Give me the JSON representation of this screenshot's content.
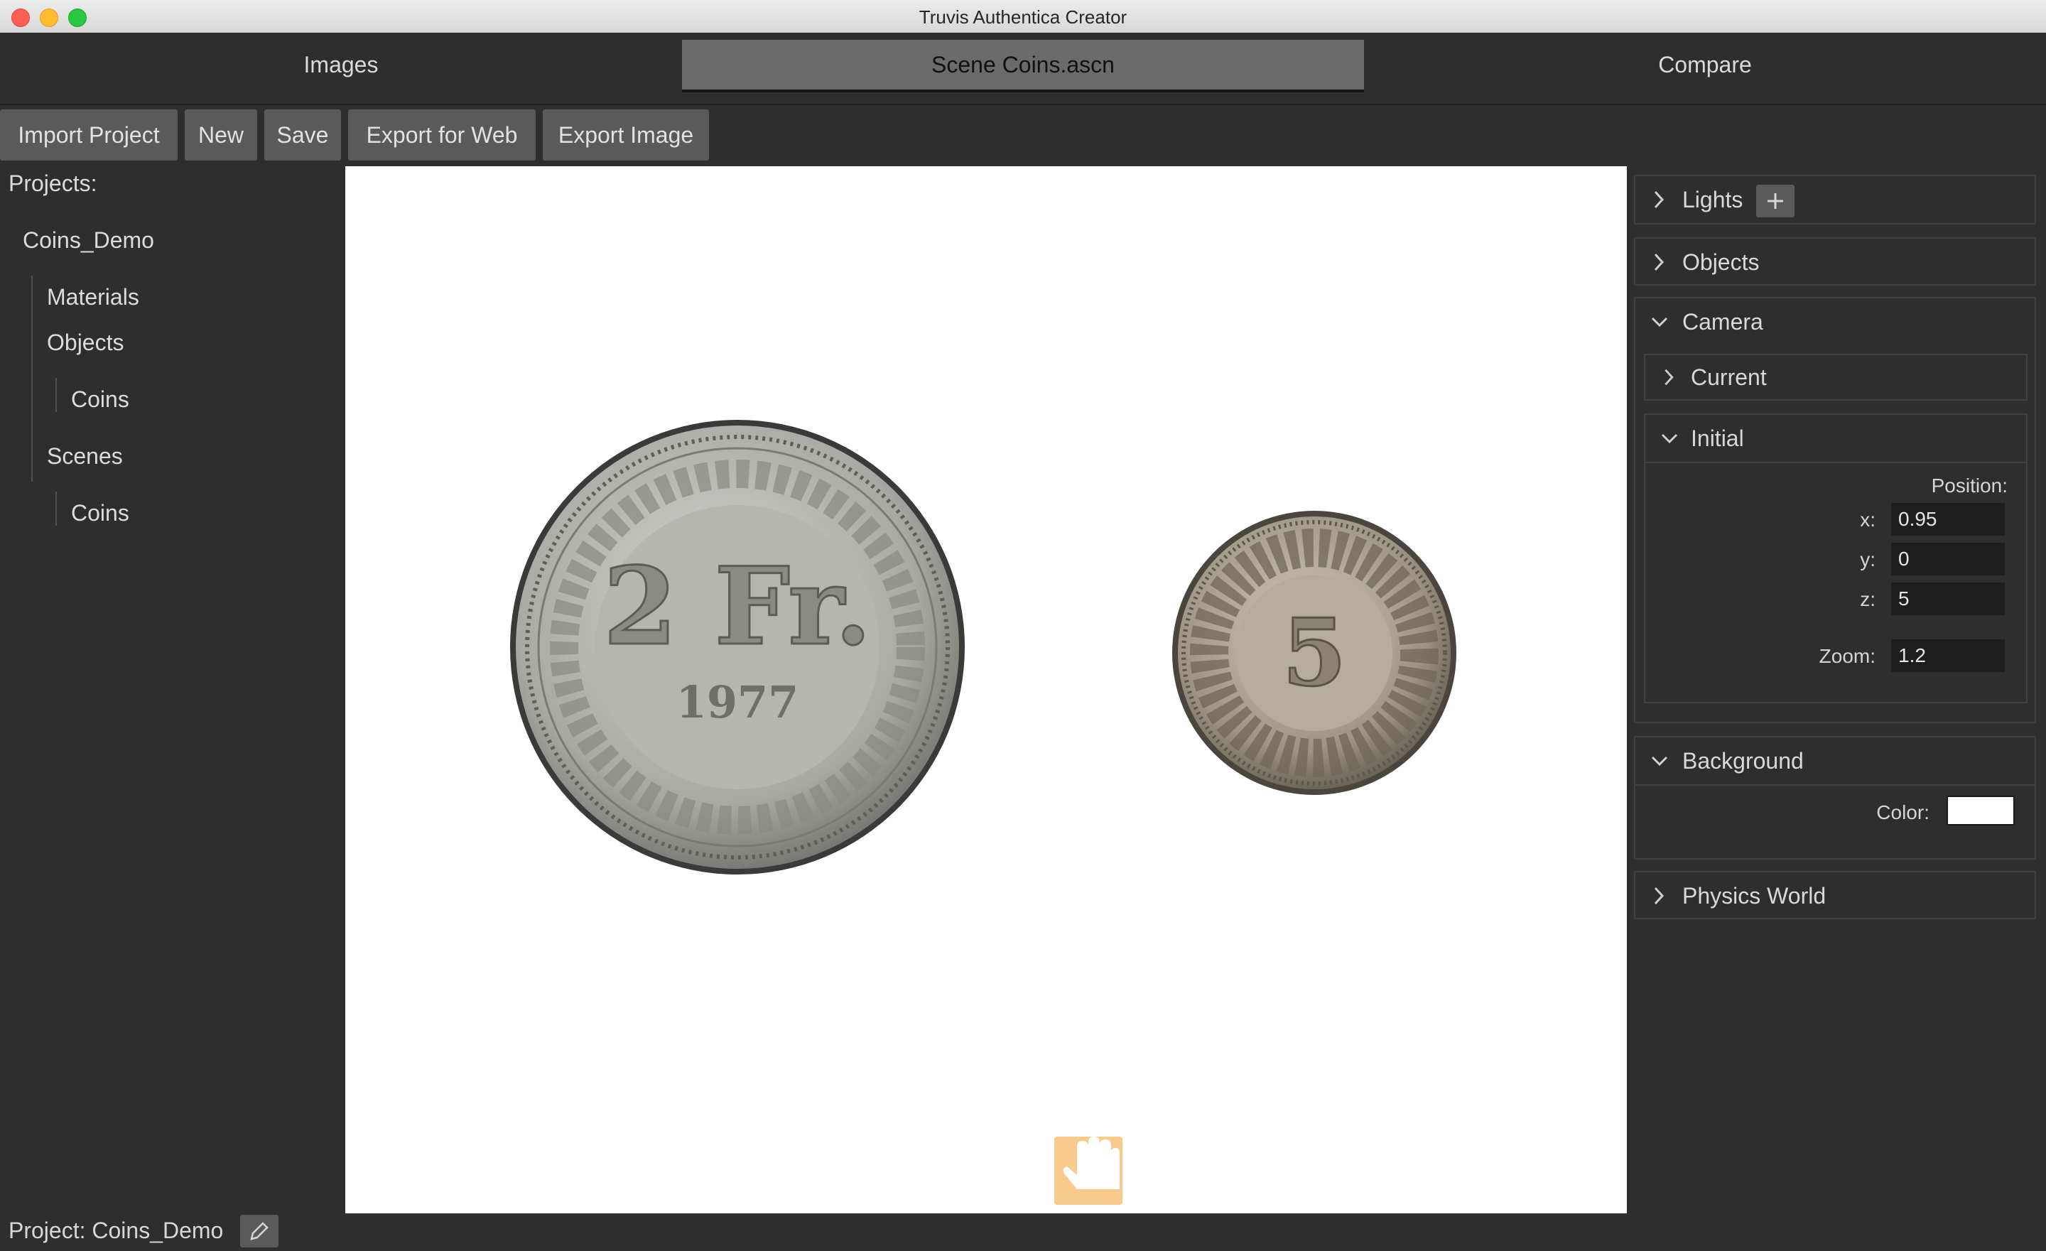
{
  "window": {
    "title": "Truvis Authentica Creator"
  },
  "tabs": [
    {
      "label": "Images",
      "active": false
    },
    {
      "label": "Scene Coins.ascn",
      "active": true
    },
    {
      "label": "Compare",
      "active": false
    }
  ],
  "toolbar": {
    "import_project": "Import Project",
    "new": "New",
    "save": "Save",
    "export_web": "Export for Web",
    "export_image": "Export Image"
  },
  "sidebar": {
    "projects_label": "Projects:",
    "project": "Coins_Demo",
    "materials": "Materials",
    "objects": "Objects",
    "objects_child": "Coins",
    "scenes": "Scenes",
    "scenes_child": "Coins"
  },
  "viewport": {
    "coin_large": {
      "denomination": "2 Fr.",
      "year": "1977"
    },
    "coin_small": {
      "denomination": "5"
    },
    "pan_icon": "hand-pan-icon"
  },
  "inspector": {
    "lights": {
      "label": "Lights",
      "add_icon": "plus-icon"
    },
    "objects": {
      "label": "Objects"
    },
    "camera": {
      "label": "Camera",
      "current_label": "Current",
      "initial_label": "Initial",
      "position_label": "Position:",
      "x_label": "x:",
      "x": "0.95",
      "y_label": "y:",
      "y": "0",
      "z_label": "z:",
      "z": "5",
      "zoom_label": "Zoom:",
      "zoom": "1.2"
    },
    "background": {
      "label": "Background",
      "color_label": "Color:",
      "color": "#ffffff"
    },
    "physics": {
      "label": "Physics World"
    }
  },
  "status": {
    "project": "Project: Coins_Demo",
    "edit_icon": "pencil-icon"
  },
  "colors": {
    "bg": "#2e2e2e",
    "active_tab": "#6b6b6b",
    "button": "#5a5a5a",
    "input": "#1e1e1e"
  }
}
